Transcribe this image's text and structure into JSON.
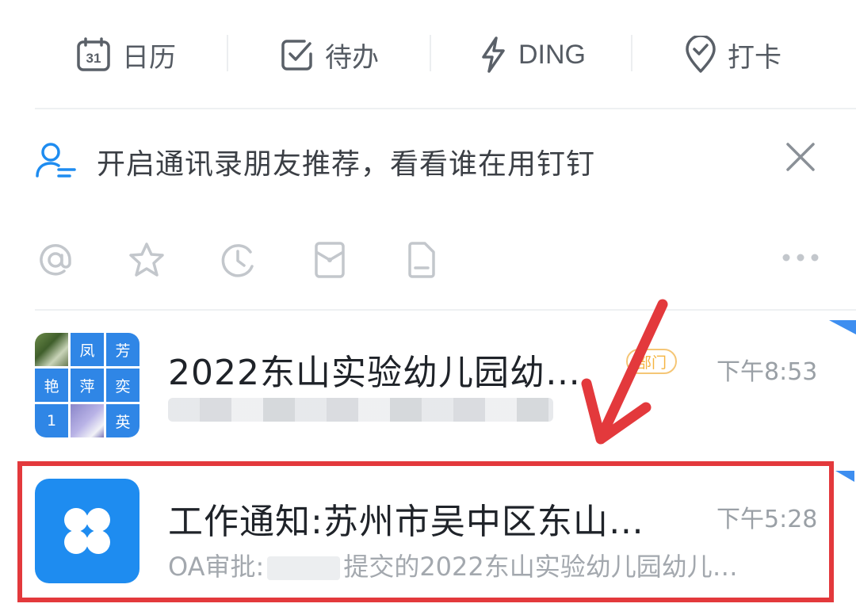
{
  "quickbar": {
    "items": [
      {
        "label": "日历",
        "icon": "calendar-icon",
        "icon_text": "31"
      },
      {
        "label": "待办",
        "icon": "todo-check-icon"
      },
      {
        "label": "DING",
        "icon": "lightning-icon"
      },
      {
        "label": "打卡",
        "icon": "location-check-icon"
      }
    ]
  },
  "banner": {
    "text": "开启通讯录朋友推荐，看看谁在用钉钉",
    "icon": "contacts-person-icon",
    "close_icon": "close-icon"
  },
  "filters": {
    "icons": [
      "at-mention-icon",
      "star-icon",
      "clock-icon",
      "red-packet-icon",
      "document-icon",
      "more-icon"
    ]
  },
  "chats": [
    {
      "title": "2022东山实验幼儿园幼…",
      "time": "下午8:53",
      "badge": "部门",
      "avatar_cells": [
        "",
        "凤",
        "芳",
        "艳",
        "萍",
        "奕",
        "1",
        "",
        "英"
      ]
    },
    {
      "title": "工作通知:苏州市吴中区东山…",
      "time": "下午5:28",
      "preview_before": "OA审批:",
      "preview_after": "提交的2022东山实验幼儿园幼儿…"
    }
  ],
  "colors": {
    "accent": "#1e8cf0",
    "highlight_border": "#e3393c",
    "badge": "#f5b441"
  }
}
